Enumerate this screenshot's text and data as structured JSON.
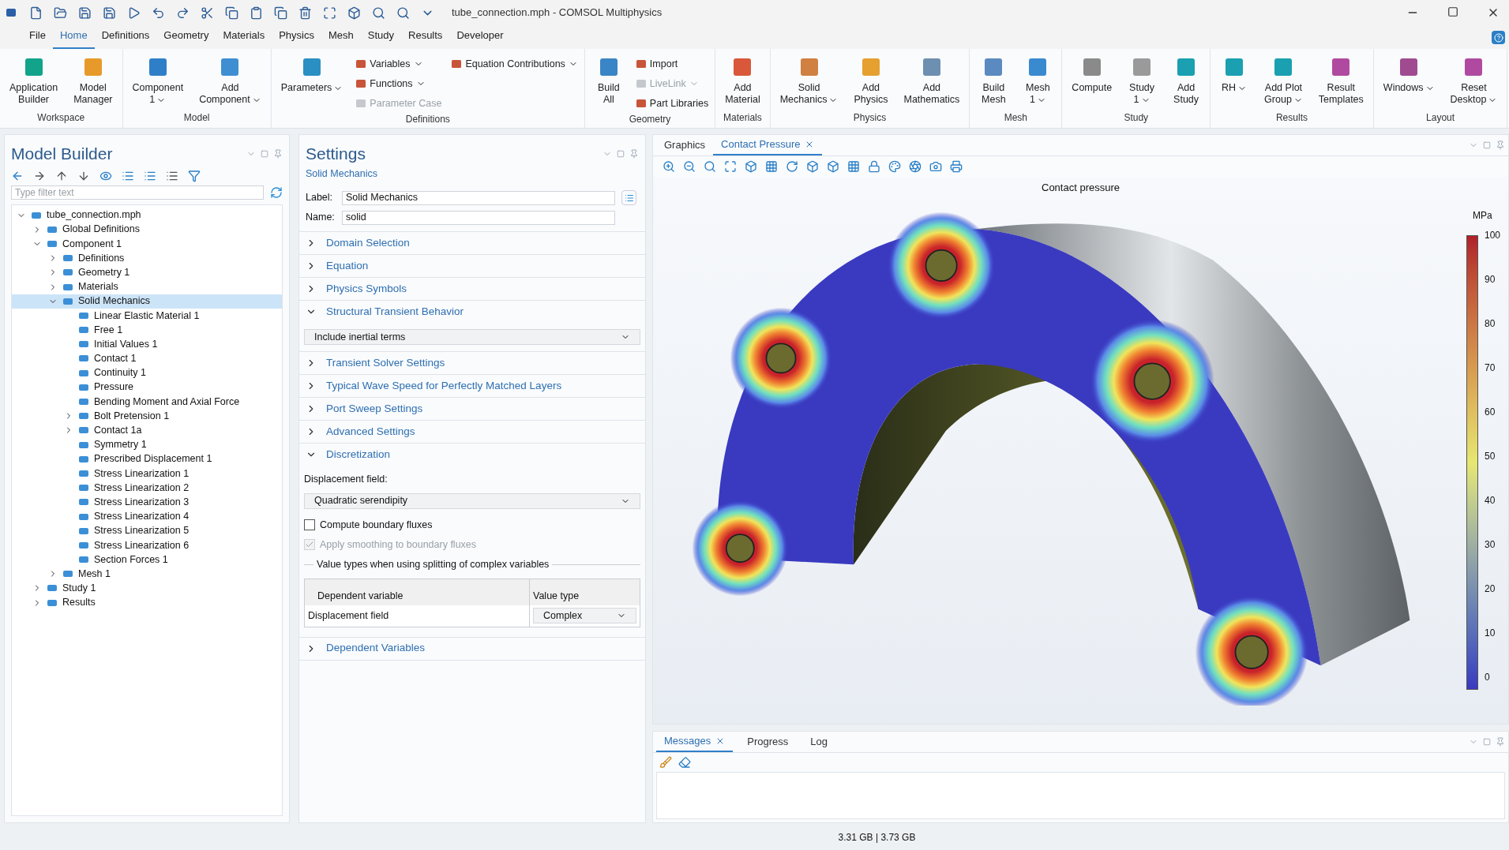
{
  "window": {
    "title": "tube_connection.mph - COMSOL Multiphysics"
  },
  "menu_tabs": [
    {
      "label": "File",
      "selected": false
    },
    {
      "label": "Home",
      "selected": true
    },
    {
      "label": "Definitions",
      "selected": false
    },
    {
      "label": "Geometry",
      "selected": false
    },
    {
      "label": "Materials",
      "selected": false
    },
    {
      "label": "Physics",
      "selected": false
    },
    {
      "label": "Mesh",
      "selected": false
    },
    {
      "label": "Study",
      "selected": false
    },
    {
      "label": "Results",
      "selected": false
    },
    {
      "label": "Developer",
      "selected": false
    }
  ],
  "ribbon": [
    {
      "name": "Workspace",
      "items": [
        {
          "kind": "large",
          "lines": [
            "Application",
            "Builder"
          ],
          "dropdown": false
        },
        {
          "kind": "large",
          "lines": [
            "Model",
            "Manager"
          ],
          "dropdown": false
        }
      ]
    },
    {
      "name": "Model",
      "items": [
        {
          "kind": "large",
          "lines": [
            "Component",
            "1"
          ],
          "dropdown": true
        },
        {
          "kind": "large",
          "lines": [
            "Add",
            "Component"
          ],
          "dropdown": true
        }
      ]
    },
    {
      "name": "Definitions",
      "items": [
        {
          "kind": "large",
          "lines": [
            "Parameters"
          ],
          "dropdown": true
        },
        {
          "kind": "column",
          "items": [
            {
              "label": "Variables",
              "dropdown": true,
              "disabled": false
            },
            {
              "label": "Functions",
              "dropdown": true,
              "disabled": false
            },
            {
              "label": "Parameter Case",
              "dropdown": false,
              "disabled": true
            }
          ]
        },
        {
          "kind": "column",
          "items": [
            {
              "label": "Equation Contributions",
              "dropdown": true,
              "disabled": false
            }
          ]
        }
      ]
    },
    {
      "name": "Geometry",
      "items": [
        {
          "kind": "large",
          "lines": [
            "Build",
            "All"
          ],
          "dropdown": false
        },
        {
          "kind": "column",
          "items": [
            {
              "label": "Import",
              "dropdown": false,
              "disabled": false
            },
            {
              "label": "LiveLink",
              "dropdown": true,
              "disabled": true
            },
            {
              "label": "Part Libraries",
              "dropdown": false,
              "disabled": false
            }
          ]
        }
      ]
    },
    {
      "name": "Materials",
      "items": [
        {
          "kind": "large",
          "lines": [
            "Add",
            "Material"
          ],
          "dropdown": false
        }
      ]
    },
    {
      "name": "Physics",
      "items": [
        {
          "kind": "large",
          "lines": [
            "Solid",
            "Mechanics"
          ],
          "dropdown": true
        },
        {
          "kind": "large",
          "lines": [
            "Add",
            "Physics"
          ],
          "dropdown": false
        },
        {
          "kind": "large",
          "lines": [
            "Add",
            "Mathematics"
          ],
          "dropdown": false
        }
      ]
    },
    {
      "name": "Mesh",
      "items": [
        {
          "kind": "large",
          "lines": [
            "Build",
            "Mesh"
          ],
          "dropdown": false
        },
        {
          "kind": "large",
          "lines": [
            "Mesh",
            "1"
          ],
          "dropdown": true
        }
      ]
    },
    {
      "name": "Study",
      "items": [
        {
          "kind": "large",
          "lines": [
            "Compute"
          ],
          "dropdown": false
        },
        {
          "kind": "large",
          "lines": [
            "Study",
            "1"
          ],
          "dropdown": true
        },
        {
          "kind": "large",
          "lines": [
            "Add",
            "Study"
          ],
          "dropdown": false
        }
      ]
    },
    {
      "name": "Results",
      "items": [
        {
          "kind": "large",
          "lines": [
            "RH"
          ],
          "dropdown": true
        },
        {
          "kind": "large",
          "lines": [
            "Add Plot",
            "Group"
          ],
          "dropdown": true
        },
        {
          "kind": "large",
          "lines": [
            "Result",
            "Templates"
          ],
          "dropdown": false
        }
      ]
    },
    {
      "name": "Layout",
      "items": [
        {
          "kind": "large",
          "lines": [
            "Windows"
          ],
          "dropdown": true
        },
        {
          "kind": "large",
          "lines": [
            "Reset",
            "Desktop"
          ],
          "dropdown": true
        }
      ]
    }
  ],
  "model_builder": {
    "title": "Model Builder",
    "filter_placeholder": "Type filter text",
    "tree": [
      {
        "label": "tube_connection.mph",
        "expanded": true,
        "selected": false,
        "children": [
          {
            "label": "Global Definitions",
            "expanded": false,
            "selected": false
          },
          {
            "label": "Component 1",
            "expanded": true,
            "selected": false,
            "children": [
              {
                "label": "Definitions",
                "expanded": false,
                "selected": false
              },
              {
                "label": "Geometry 1",
                "expanded": false,
                "selected": false
              },
              {
                "label": "Materials",
                "expanded": false,
                "selected": false
              },
              {
                "label": "Solid Mechanics",
                "expanded": true,
                "selected": true,
                "children": [
                  {
                    "label": "Linear Elastic Material 1",
                    "selected": false
                  },
                  {
                    "label": "Free 1",
                    "selected": false
                  },
                  {
                    "label": "Initial Values 1",
                    "selected": false
                  },
                  {
                    "label": "Contact 1",
                    "selected": false
                  },
                  {
                    "label": "Continuity 1",
                    "selected": false
                  },
                  {
                    "label": "Pressure",
                    "selected": false
                  },
                  {
                    "label": "Bending Moment and Axial Force",
                    "selected": false
                  },
                  {
                    "label": "Bolt Pretension 1",
                    "expanded": false,
                    "selected": false
                  },
                  {
                    "label": "Contact 1a",
                    "expanded": false,
                    "selected": false
                  },
                  {
                    "label": "Symmetry 1",
                    "selected": false
                  },
                  {
                    "label": "Prescribed Displacement 1",
                    "selected": false
                  },
                  {
                    "label": "Stress Linearization 1",
                    "selected": false
                  },
                  {
                    "label": "Stress Linearization 2",
                    "selected": false
                  },
                  {
                    "label": "Stress Linearization 3",
                    "selected": false
                  },
                  {
                    "label": "Stress Linearization 4",
                    "selected": false
                  },
                  {
                    "label": "Stress Linearization 5",
                    "selected": false
                  },
                  {
                    "label": "Stress Linearization 6",
                    "selected": false
                  },
                  {
                    "label": "Section Forces 1",
                    "selected": false
                  }
                ]
              },
              {
                "label": "Mesh 1",
                "expanded": false,
                "selected": false
              }
            ]
          },
          {
            "label": "Study 1",
            "expanded": false,
            "selected": false
          },
          {
            "label": "Results",
            "expanded": false,
            "selected": false
          }
        ]
      }
    ]
  },
  "settings": {
    "title": "Settings",
    "subtitle": "Solid Mechanics",
    "label_caption": "Label:",
    "label_value": "Solid Mechanics",
    "name_caption": "Name:",
    "name_value": "solid",
    "sections": [
      {
        "title": "Domain Selection",
        "expanded": false
      },
      {
        "title": "Equation",
        "expanded": false
      },
      {
        "title": "Physics Symbols",
        "expanded": false
      },
      {
        "title": "Structural Transient Behavior",
        "expanded": true,
        "content": [
          {
            "kind": "select",
            "value": "Include inertial terms"
          }
        ]
      },
      {
        "title": "Transient Solver Settings",
        "expanded": false
      },
      {
        "title": "Typical Wave Speed for Perfectly Matched Layers",
        "expanded": false
      },
      {
        "title": "Port Sweep Settings",
        "expanded": false
      },
      {
        "title": "Advanced Settings",
        "expanded": false
      },
      {
        "title": "Discretization",
        "expanded": true,
        "content": [
          {
            "kind": "caption",
            "text": "Displacement field:"
          },
          {
            "kind": "select",
            "value": "Quadratic serendipity"
          },
          {
            "kind": "checkbox",
            "label": "Compute boundary fluxes",
            "checked": false,
            "disabled": false
          },
          {
            "kind": "checkbox",
            "label": "Apply smoothing to boundary fluxes",
            "checked": true,
            "disabled": true
          },
          {
            "kind": "group_title",
            "text": "Value types when using splitting of complex variables"
          },
          {
            "kind": "table",
            "columns": [
              "Dependent variable",
              "Value type"
            ],
            "rows": [
              {
                "variable": "Displacement field",
                "value_type": "Complex"
              }
            ]
          }
        ]
      },
      {
        "title": "Dependent Variables",
        "expanded": false
      }
    ]
  },
  "graphics": {
    "tabs": [
      {
        "label": "Graphics",
        "selected": false,
        "closable": false
      },
      {
        "label": "Contact Pressure",
        "selected": true,
        "closable": true
      }
    ],
    "plot_title": "Contact pressure",
    "unit": "MPa",
    "ticks": [
      "100",
      "90",
      "80",
      "70",
      "60",
      "50",
      "40",
      "30",
      "20",
      "10",
      "0"
    ]
  },
  "messages": {
    "tabs": [
      {
        "label": "Messages",
        "selected": true,
        "closable": true
      },
      {
        "label": "Progress",
        "selected": false,
        "closable": false
      },
      {
        "label": "Log",
        "selected": false,
        "closable": false
      }
    ]
  },
  "status_bar": {
    "memory": "3.31 GB | 3.73 GB"
  }
}
